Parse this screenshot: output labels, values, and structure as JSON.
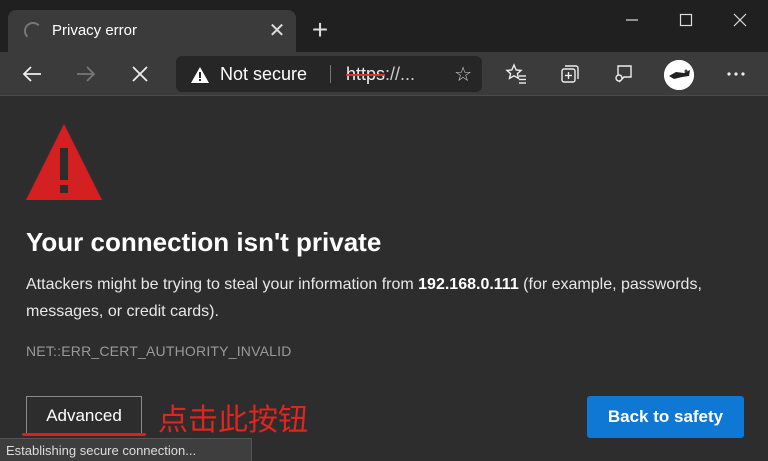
{
  "tab": {
    "title": "Privacy error",
    "close": "✕",
    "new_tab": "+"
  },
  "toolbar": {
    "security_label": "Not secure",
    "url_scheme": "https",
    "url_rest": "://...",
    "star": "☆"
  },
  "page": {
    "headline": "Your connection isn't private",
    "desc_pre": "Attackers might be trying to steal your information from ",
    "desc_host": "192.168.0.111",
    "desc_post": " (for example, passwords, messages, or credit cards).",
    "error_code": "NET::ERR_CERT_AUTHORITY_INVALID",
    "advanced_label": "Advanced",
    "annotation": "点击此按钮",
    "back_label": "Back to safety"
  },
  "status": "Establishing secure connection...",
  "colors": {
    "warning_red": "#d42020",
    "accent_blue": "#0f78d4",
    "annotation_red": "#e0241e"
  },
  "icons": [
    "loading-spinner-icon",
    "back-arrow-icon",
    "forward-arrow-icon",
    "stop-icon",
    "warning-icon",
    "favorite-star-icon",
    "favorites-icon",
    "collections-icon",
    "feedback-icon",
    "profile-avatar",
    "more-icon",
    "minimize-icon",
    "maximize-icon",
    "close-window-icon"
  ]
}
